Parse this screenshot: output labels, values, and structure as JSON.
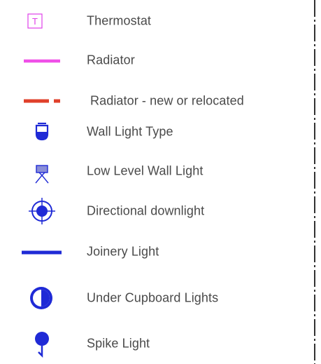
{
  "legend": {
    "items": [
      {
        "key": "thermostat",
        "label": "Thermostat",
        "icon": "thermostat-icon",
        "symbol_text": "T",
        "color": "#e040e8"
      },
      {
        "key": "radiator",
        "label": "Radiator",
        "icon": "radiator-line-icon",
        "color": "#f050e8"
      },
      {
        "key": "radiator-new",
        "label": "Radiator - new or relocated",
        "icon": "radiator-dashed-line-icon",
        "color": "#e0402a"
      },
      {
        "key": "wall-light-type",
        "label": "Wall Light Type",
        "icon": "wall-light-icon",
        "color": "#1f2ad6"
      },
      {
        "key": "low-level-wall-light",
        "label": "Low Level Wall Light",
        "icon": "low-level-wall-light-icon",
        "color": "#1f2ad6"
      },
      {
        "key": "directional-downlight",
        "label": "Directional downlight",
        "icon": "directional-downlight-icon",
        "color": "#1f2ad6"
      },
      {
        "key": "joinery-light",
        "label": "Joinery Light",
        "icon": "joinery-light-line-icon",
        "color": "#1f2ad6"
      },
      {
        "key": "under-cupboard-lights",
        "label": "Under Cupboard Lights",
        "icon": "under-cupboard-light-icon",
        "color": "#1f2ad6"
      },
      {
        "key": "spike-light",
        "label": "Spike Light",
        "icon": "spike-light-icon",
        "color": "#1f2ad6"
      }
    ]
  },
  "border": {
    "style": "dash-dot",
    "color": "#000000"
  }
}
